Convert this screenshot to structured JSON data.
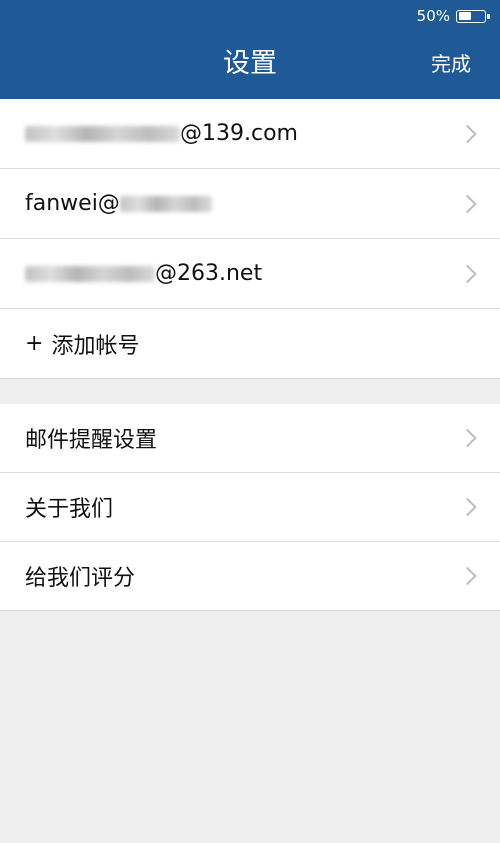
{
  "status_bar": {
    "battery_percent_text": "50%",
    "battery_level": 0.5
  },
  "header": {
    "title": "设置",
    "done_label": "完成"
  },
  "accounts": [
    {
      "visible_text": "@139.com",
      "has_redaction": true
    },
    {
      "visible_text": "fanwei@",
      "has_redaction": true
    },
    {
      "visible_text": "@263.net",
      "has_redaction": true
    }
  ],
  "add_account": {
    "plus": "+",
    "label": "添加帐号"
  },
  "settings_menu": [
    {
      "label": "邮件提醒设置"
    },
    {
      "label": "关于我们"
    },
    {
      "label": "给我们评分"
    }
  ],
  "colors": {
    "header_bg": "#1f5a97",
    "page_bg": "#efefef",
    "row_bg": "#ffffff",
    "chevron": "#bdbdbd"
  }
}
